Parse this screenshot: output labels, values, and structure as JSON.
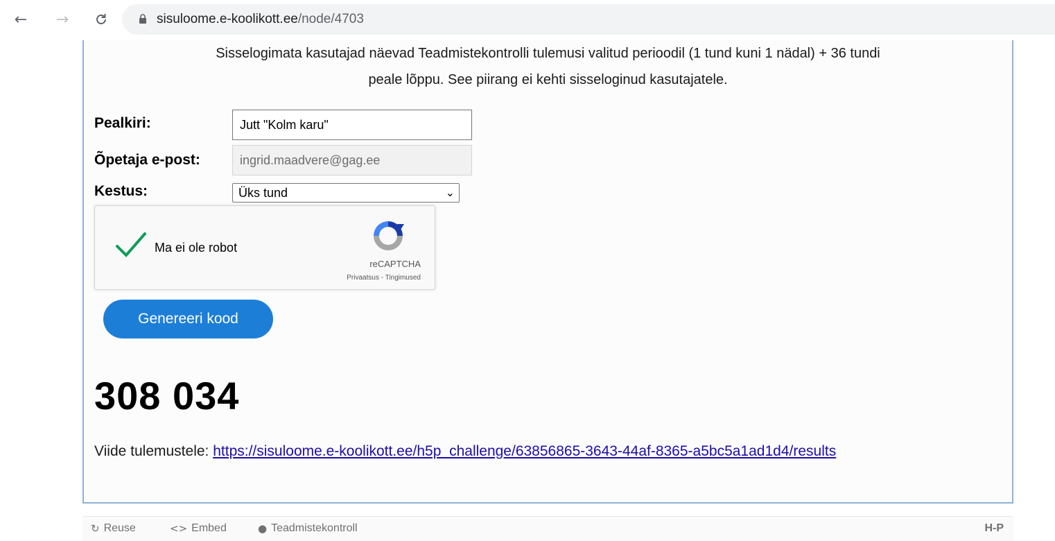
{
  "browser": {
    "url_host": "sisuloome.e-koolikott.ee",
    "url_path": "/node/4703"
  },
  "notice": {
    "line1": "Sisselogimata kasutajad näevad Teadmistekontrolli tulemusi valitud perioodil (1 tund kuni 1 nädal) + 36 tundi",
    "line2": "peale lõppu. See piirang ei kehti sisseloginud kasutajatele."
  },
  "form": {
    "title_label": "Pealkiri:",
    "title_value": "Jutt \"Kolm karu\"",
    "email_label": "Õpetaja e-post:",
    "email_value": "ingrid.maadvere@gag.ee",
    "duration_label": "Kestus:",
    "duration_value": "Üks tund"
  },
  "captcha": {
    "label": "Ma ei ole robot",
    "brand": "reCAPTCHA",
    "privacy": "Privaatsus",
    "separator": " - ",
    "terms": "Tingimused",
    "checked": true
  },
  "generate_button": "Genereeri kood",
  "code": "308 034",
  "results": {
    "label": "Viide tulemustele: ",
    "link": "https://sisuloome.e-koolikott.ee/h5p_challenge/63856865-3643-44af-8365-a5bc5a1ad1d4/results"
  },
  "footer": {
    "reuse": "Reuse",
    "embed": "Embed",
    "challenge": "Teadmistekontroll",
    "logo": "H-P"
  },
  "colors": {
    "frame_border": "#8fb2d6",
    "button_bg": "#1d7ed8",
    "link": "#1a0dab",
    "check": "#0f9d58"
  }
}
